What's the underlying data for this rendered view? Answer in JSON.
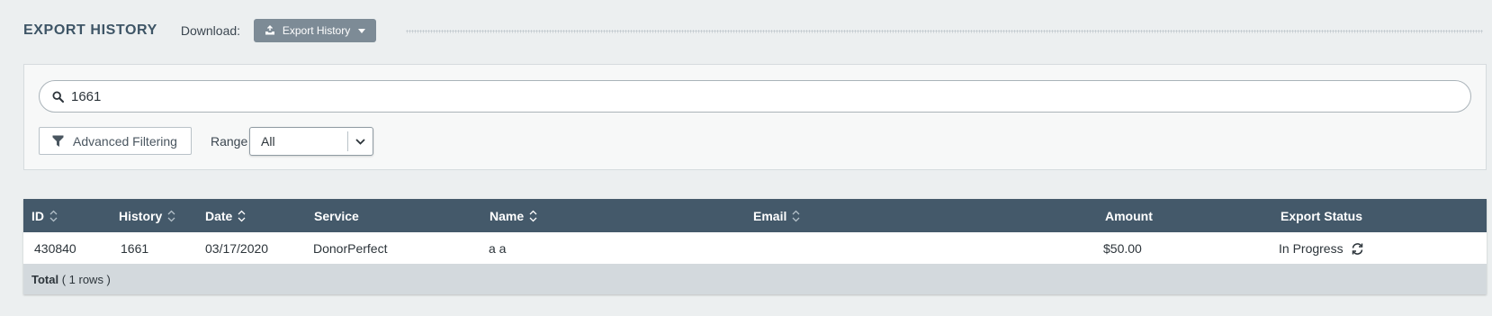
{
  "header": {
    "title": "EXPORT HISTORY",
    "download_label": "Download:",
    "export_button_label": "Export History"
  },
  "filters": {
    "search_value": "1661",
    "advanced_filtering_label": "Advanced Filtering",
    "range_label": "Range",
    "range_value": "All"
  },
  "table": {
    "columns": [
      "ID",
      "History",
      "Date",
      "Service",
      "Name",
      "Email",
      "Amount",
      "Export Status"
    ],
    "rows": [
      {
        "id": "430840",
        "history": "1661",
        "date": "03/17/2020",
        "service": "DonorPerfect",
        "name": "a a",
        "email": "",
        "amount": "$50.00",
        "export_status": "In Progress"
      }
    ],
    "footer": {
      "total_label": "Total",
      "rows_text": "( 1 rows )"
    }
  },
  "icons": {
    "export": "export-tray-icon",
    "caret": "caret-down-icon",
    "search": "search-icon",
    "filter": "funnel-icon",
    "chevron": "chevron-down-icon",
    "sort": "sort-icon",
    "refresh": "refresh-icon"
  },
  "colors": {
    "background": "#eceff0",
    "title": "#3e5566",
    "export_button": "#7d8b96",
    "table_header": "#44596a",
    "table_footer": "#d3d9dd"
  }
}
